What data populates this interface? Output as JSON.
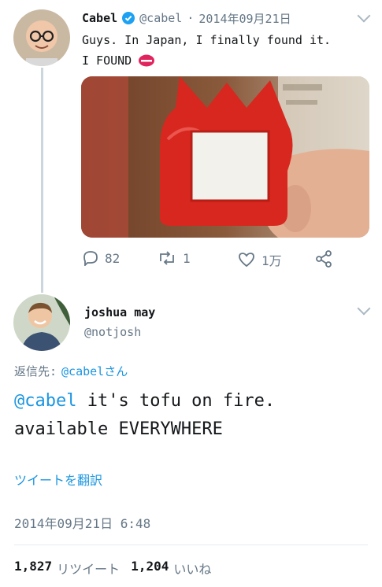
{
  "tweet1": {
    "display_name": "Cabel",
    "handle": "@cabel",
    "separator": "·",
    "date": "2014年09月21日",
    "text_line1": "Guys. In Japan, I finally found it.",
    "text_line2": "I FOUND",
    "emoji": "lips-icon",
    "actions": {
      "replies": "82",
      "retweets": "1",
      "likes": "1万"
    }
  },
  "tweet2": {
    "display_name": "joshua may",
    "handle": "@notjosh",
    "reply_to_label": "返信先:",
    "reply_to_user": "@cabelさん",
    "mention": "@cabel",
    "text_after_mention": " it's tofu on fire.",
    "text_line2": "available EVERYWHERE",
    "translate_link": "ツイートを翻訳",
    "timestamp": "2014年09月21日 6:48",
    "retweet_count": "1,827",
    "retweet_label": "リツイート",
    "like_count": "1,204",
    "like_label": "いいね"
  },
  "colors": {
    "link": "#1b95e0",
    "verified": "#1da1f2",
    "muted": "#657786",
    "lips": "#e0245e"
  }
}
